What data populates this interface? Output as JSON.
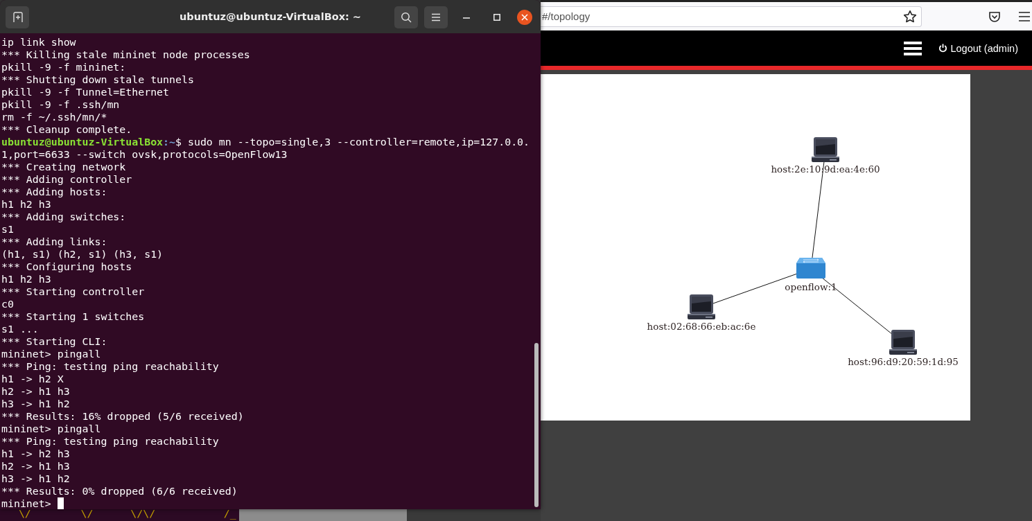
{
  "terminal": {
    "title": "ubuntuz@ubuntuz-VirtualBox: ~",
    "lines": [
      {
        "kind": "output",
        "text": "ip link show"
      },
      {
        "kind": "output",
        "text": "*** Killing stale mininet node processes"
      },
      {
        "kind": "output",
        "text": "pkill -9 -f mininet:"
      },
      {
        "kind": "output",
        "text": "*** Shutting down stale tunnels"
      },
      {
        "kind": "output",
        "text": "pkill -9 -f Tunnel=Ethernet"
      },
      {
        "kind": "output",
        "text": "pkill -9 -f .ssh/mn"
      },
      {
        "kind": "output",
        "text": "rm -f ~/.ssh/mn/*"
      },
      {
        "kind": "output",
        "text": "*** Cleanup complete."
      },
      {
        "kind": "prompt",
        "user": "ubuntuz@ubuntuz-VirtualBox",
        "path": ":~",
        "text": "$ sudo mn --topo=single,3 --controller=remote,ip=127.0.0.1,port=6633 --switch ovsk,protocols=OpenFlow13"
      },
      {
        "kind": "output",
        "text": "*** Creating network"
      },
      {
        "kind": "output",
        "text": "*** Adding controller"
      },
      {
        "kind": "output",
        "text": "*** Adding hosts:"
      },
      {
        "kind": "output",
        "text": "h1 h2 h3"
      },
      {
        "kind": "output",
        "text": "*** Adding switches:"
      },
      {
        "kind": "output",
        "text": "s1"
      },
      {
        "kind": "output",
        "text": "*** Adding links:"
      },
      {
        "kind": "output",
        "text": "(h1, s1) (h2, s1) (h3, s1)"
      },
      {
        "kind": "output",
        "text": "*** Configuring hosts"
      },
      {
        "kind": "output",
        "text": "h1 h2 h3"
      },
      {
        "kind": "output",
        "text": "*** Starting controller"
      },
      {
        "kind": "output",
        "text": "c0"
      },
      {
        "kind": "output",
        "text": "*** Starting 1 switches"
      },
      {
        "kind": "output",
        "text": "s1 ..."
      },
      {
        "kind": "output",
        "text": "*** Starting CLI:"
      },
      {
        "kind": "output",
        "text": "mininet> pingall"
      },
      {
        "kind": "output",
        "text": "*** Ping: testing ping reachability"
      },
      {
        "kind": "output",
        "text": "h1 -> h2 X"
      },
      {
        "kind": "output",
        "text": "h2 -> h1 h3"
      },
      {
        "kind": "output",
        "text": "h3 -> h1 h2"
      },
      {
        "kind": "output",
        "text": "*** Results: 16% dropped (5/6 received)"
      },
      {
        "kind": "output",
        "text": "mininet> pingall"
      },
      {
        "kind": "output",
        "text": "*** Ping: testing ping reachability"
      },
      {
        "kind": "output",
        "text": "h1 -> h2 h3"
      },
      {
        "kind": "output",
        "text": "h2 -> h1 h3"
      },
      {
        "kind": "output",
        "text": "h3 -> h1 h2"
      },
      {
        "kind": "output",
        "text": "*** Results: 0% dropped (6/6 received)"
      },
      {
        "kind": "cursor",
        "text": "mininet> "
      }
    ]
  },
  "background_terminal": {
    "text": "   \\/        \\/      \\/\\/           /_"
  },
  "browser": {
    "url": "#/topology",
    "logout": "Logout (admin)",
    "topology": {
      "switch": {
        "label": "openflow:1",
        "hosts": [
          {
            "label": "host:2e:10:9d:ea:4e:60"
          },
          {
            "label": "host:02:68:66:eb:ac:6e"
          },
          {
            "label": "host:96:d9:20:59:1d:95"
          }
        ]
      }
    }
  }
}
